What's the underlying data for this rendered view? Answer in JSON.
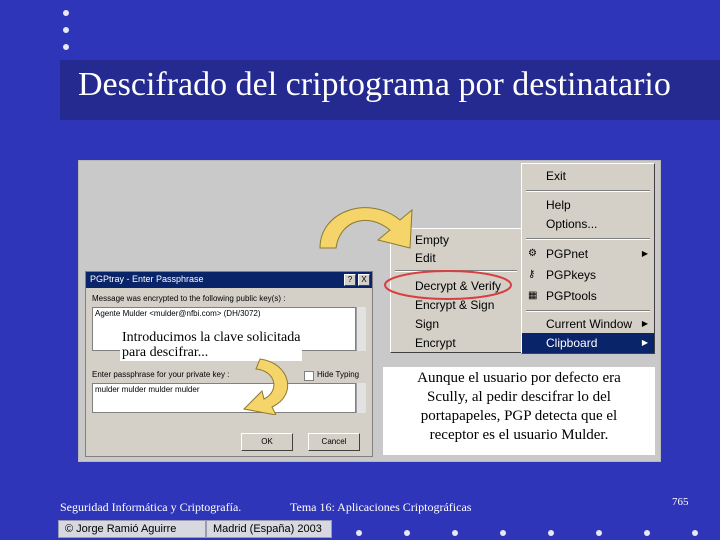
{
  "slide": {
    "title": "Descifrado del criptograma por destinatario",
    "page_number": "765"
  },
  "dialog": {
    "window_title": "PGPtray - Enter Passphrase",
    "help_button": "?",
    "close_button": "X",
    "message_label": "Message was encrypted to the following public key(s) :",
    "recipient_key": "Agente Mulder <mulder@nfbi.com> (DH/3072)",
    "passphrase_label": "Enter passphrase for your private key :",
    "hide_typing_label": "Hide Typing",
    "passphrase_value": "mulder mulder mulder mulder",
    "ok_button": "OK",
    "cancel_button": "Cancel"
  },
  "overlay": {
    "instruction_line1": "Introducimos la clave solicitada",
    "instruction_line2": "para descifrar..."
  },
  "left_menu": {
    "items": [
      "Empty",
      "Edit",
      "Decrypt & Verify",
      "Encrypt & Sign",
      "Sign",
      "Encrypt"
    ]
  },
  "right_menu": {
    "exit": "Exit",
    "help": "Help",
    "options": "Options...",
    "pgpnet": "PGPnet",
    "pgpkeys": "PGPkeys",
    "pgptools": "PGPtools",
    "current_window": "Current Window",
    "clipboard": "Clipboard"
  },
  "note": {
    "text_line1": "Aunque el usuario por defecto era",
    "text_line2": "Scully, al pedir descifrar lo del",
    "text_line3": "portapapeles, PGP detecta que el",
    "text_line4": "receptor es el usuario Mulder."
  },
  "footer": {
    "course": "Seguridad Informática y Criptografía.",
    "topic": "Tema 16:  Aplicaciones Criptográficas",
    "author": "© Jorge Ramió Aguirre",
    "place": "Madrid (España) 2003"
  },
  "colors": {
    "background": "#2f35b8",
    "title_bar": "#242a8f",
    "highlight": "#0a246a",
    "arrow": "#f5d46a",
    "circle": "#d64040"
  }
}
